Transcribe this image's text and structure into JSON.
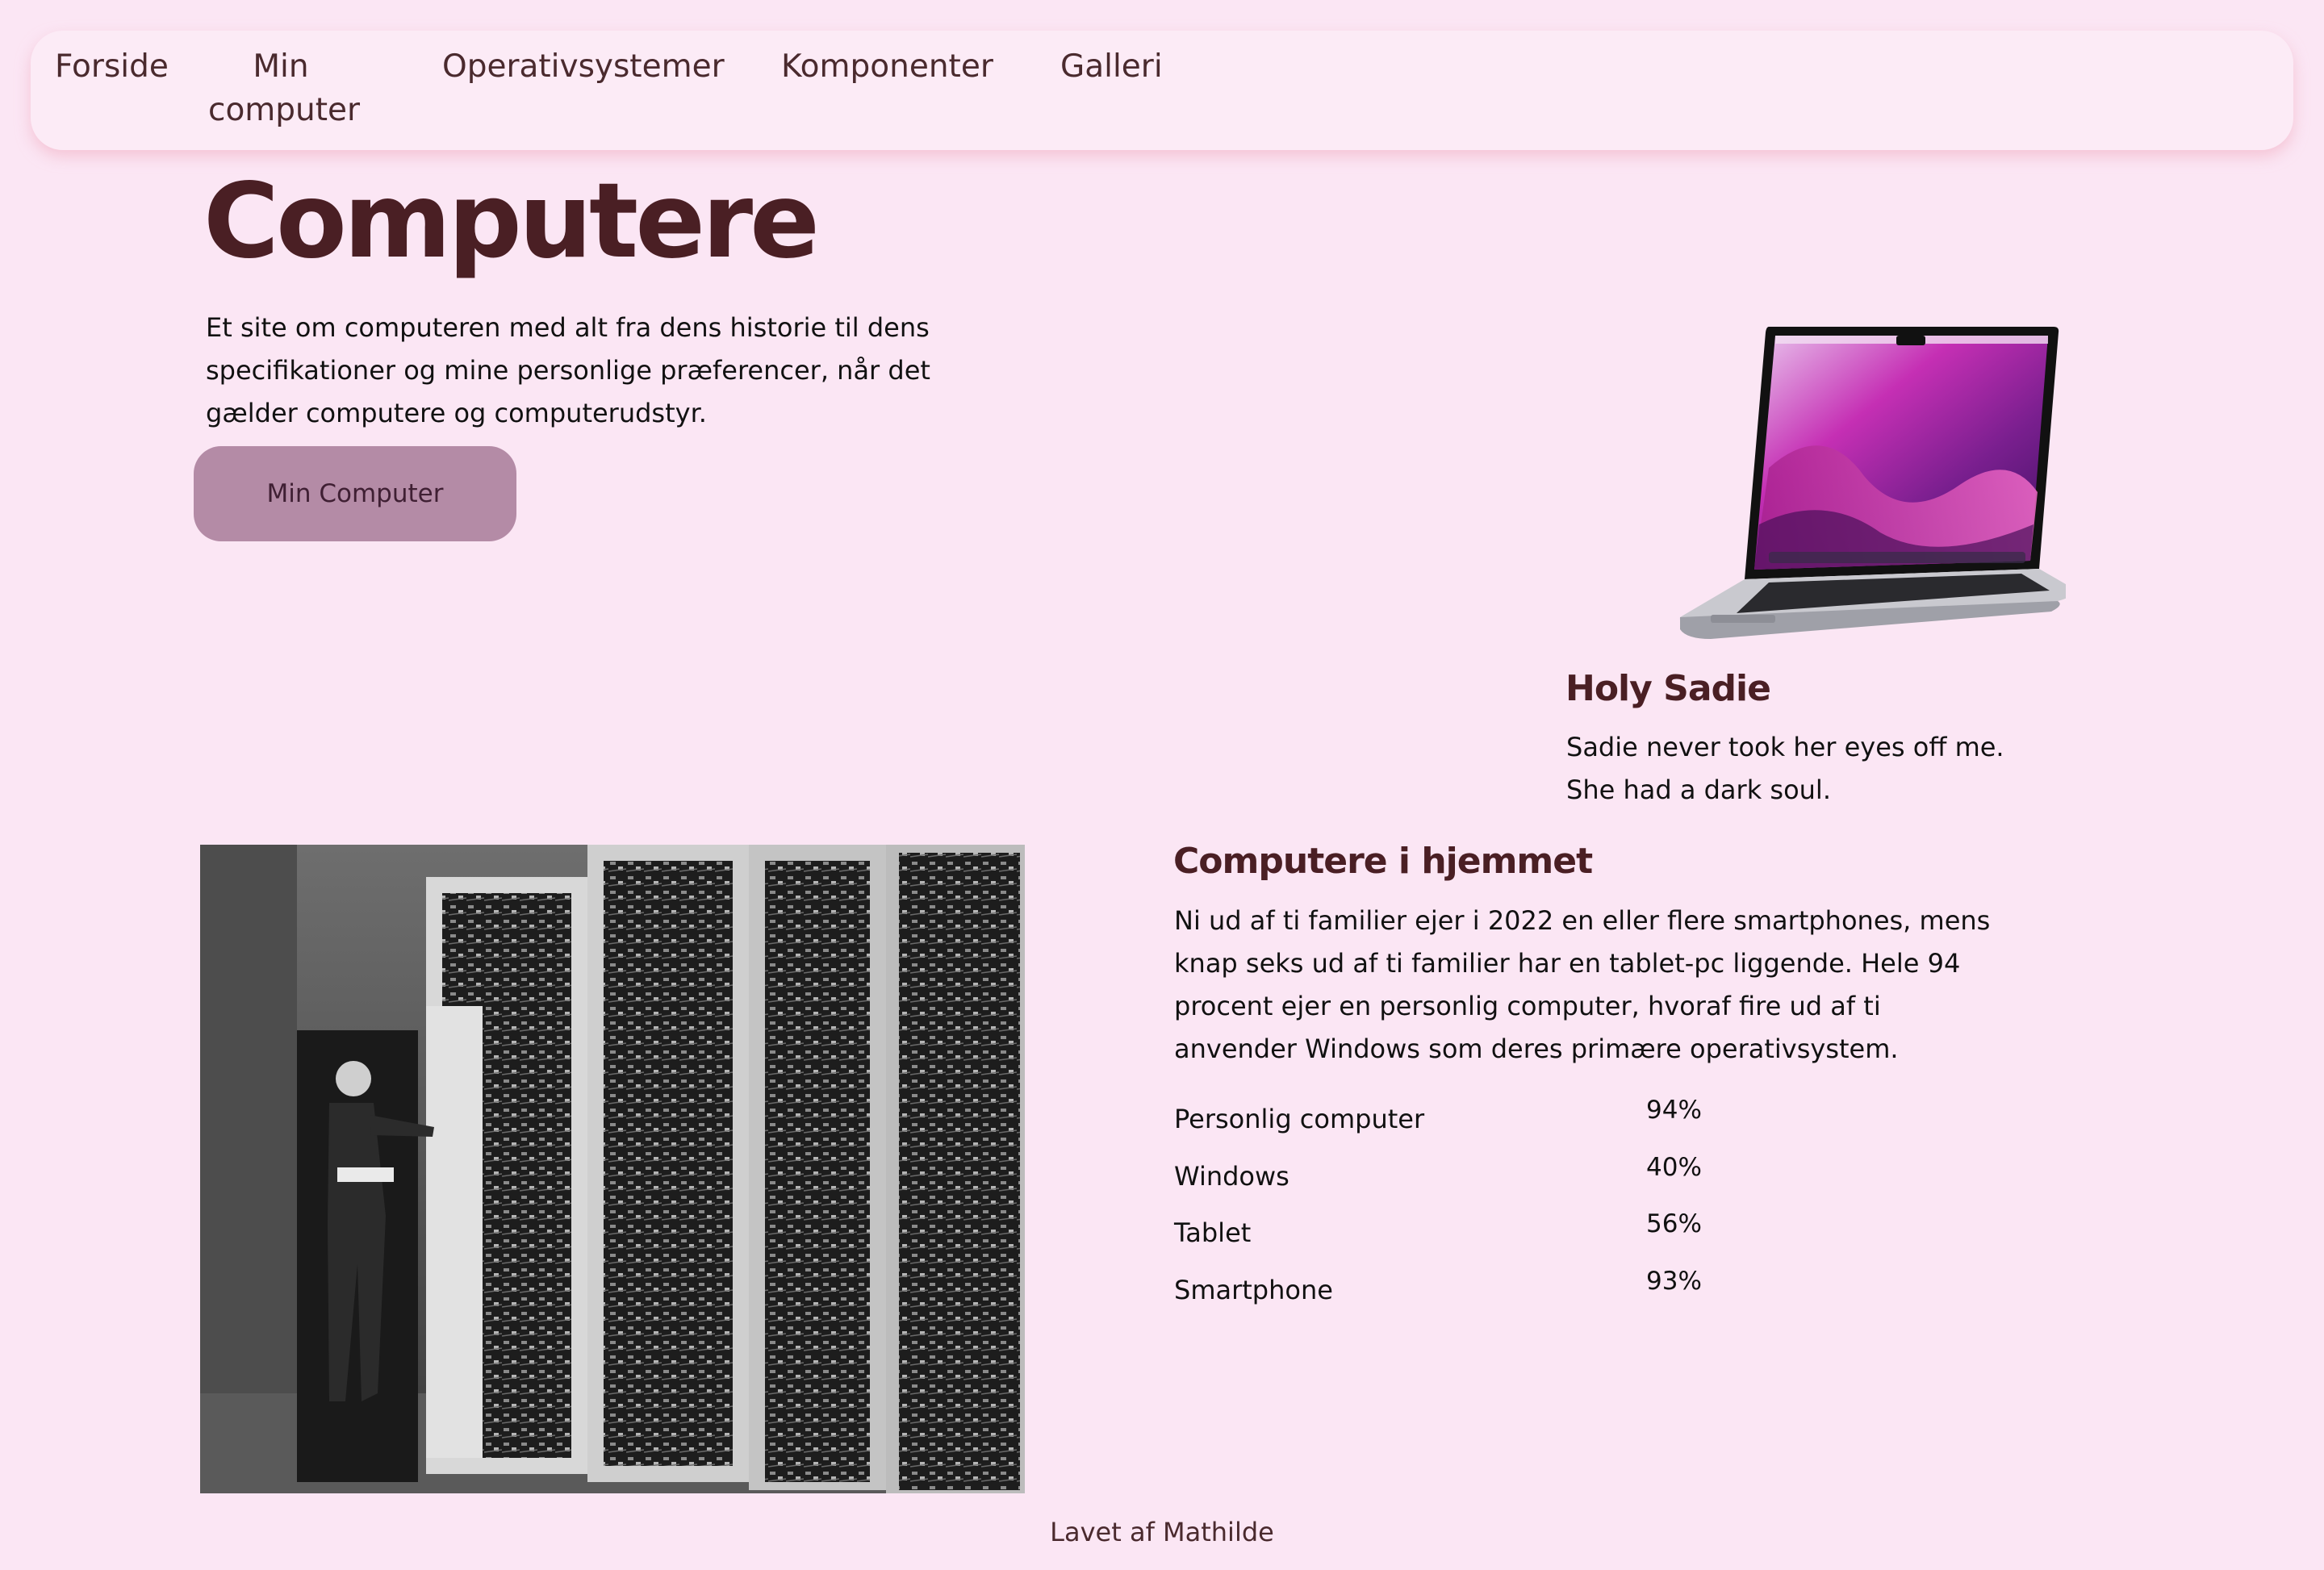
{
  "nav": {
    "items": [
      {
        "label": "Forside"
      },
      {
        "label": "Min computer"
      },
      {
        "label": "Operativsystemer"
      },
      {
        "label": "Komponenter"
      },
      {
        "label": "Galleri"
      }
    ]
  },
  "hero": {
    "title": "Computere",
    "text": "Et site om computeren med alt fra dens historie til dens specifikationer og mine personlige præferencer, når det gælder computere og computerudstyr.",
    "button_label": "Min Computer"
  },
  "sadie": {
    "title": "Holy Sadie",
    "text": "Sadie never took her eyes off me. She had a dark soul."
  },
  "home": {
    "title": "Computere i hjemmet",
    "text": "Ni ud af ti familier ejer i 2022 en eller flere smartphones, mens knap seks ud af ti familier har en tablet-pc liggende. Hele 94 procent ejer en personlig computer, hvoraf fire ud af ti anvender Windows som deres primære operativsystem.",
    "stats": [
      {
        "label": "Personlig computer",
        "value": "94%"
      },
      {
        "label": "Windows",
        "value": "40%"
      },
      {
        "label": "Tablet",
        "value": "56%"
      },
      {
        "label": "Smartphone",
        "value": "93%"
      }
    ]
  },
  "footer": {
    "text": "Lavet af Mathilde"
  },
  "colors": {
    "background": "#fbe6f4",
    "nav_bg": "#fcebf6",
    "heading": "#4a1f24",
    "button_bg": "#b48ba6"
  }
}
